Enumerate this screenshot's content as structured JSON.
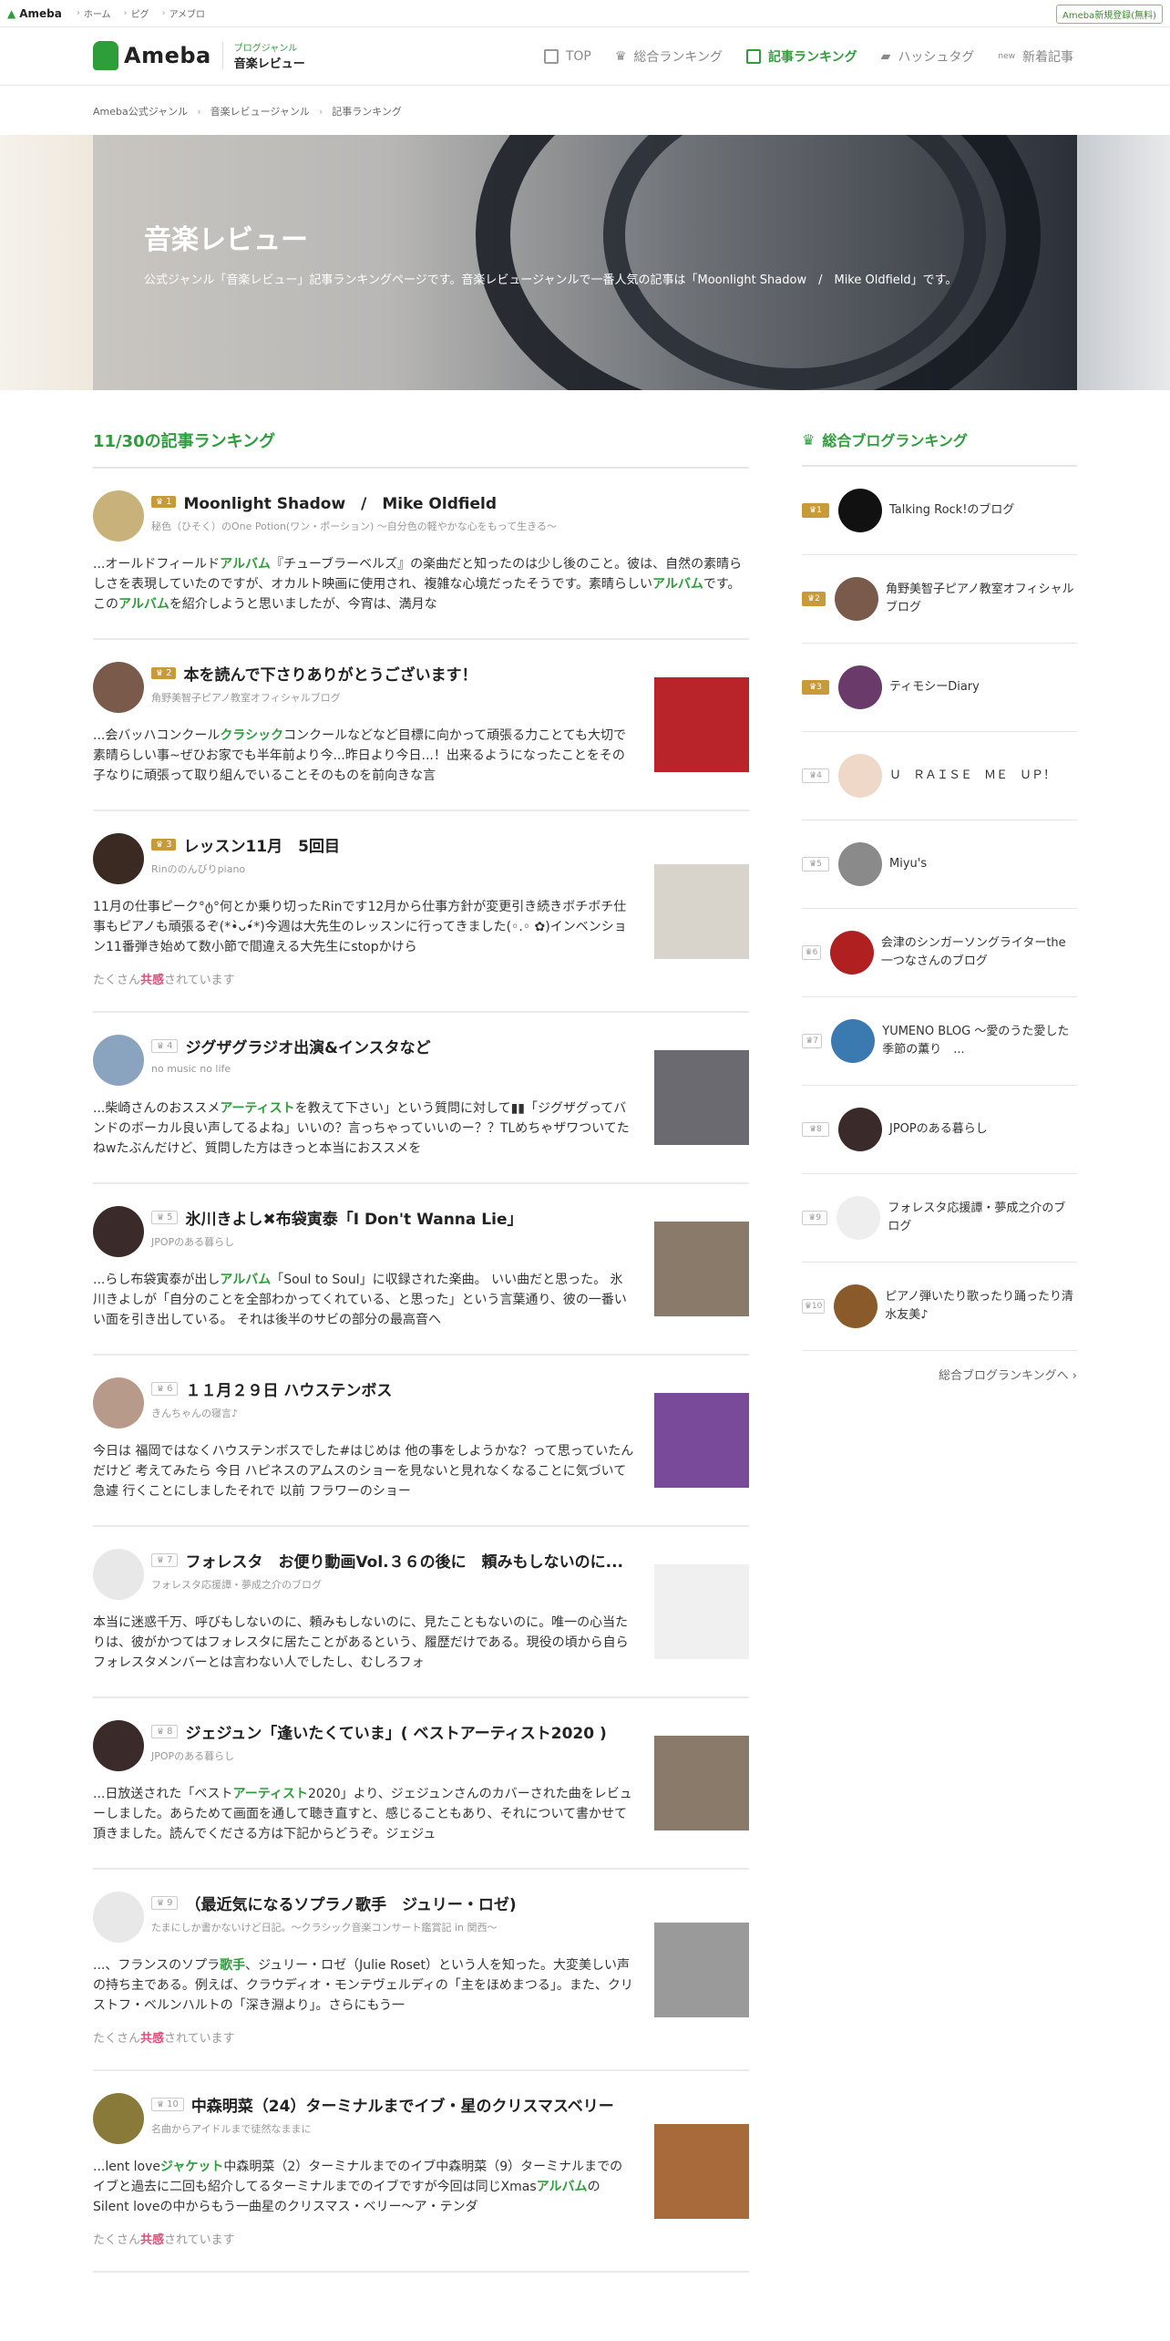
{
  "topbar": {
    "logo": "Ameba",
    "links": [
      "ホーム",
      "ピグ",
      "アメブロ"
    ],
    "register": "Ameba新規登録(無料)"
  },
  "header": {
    "brand": "Ameba",
    "genre_small": "ブログジャンル",
    "genre_name": "音楽レビュー",
    "nav": [
      {
        "label": "TOP",
        "icon": "page-icon"
      },
      {
        "label": "総合ランキング",
        "icon": "crown-icon"
      },
      {
        "label": "記事ランキング",
        "icon": "article-icon",
        "active": true
      },
      {
        "label": "ハッシュタグ",
        "icon": "tag-icon"
      },
      {
        "label": "新着記事",
        "icon": "new-icon"
      }
    ]
  },
  "breadcrumb": [
    "Ameba公式ジャンル",
    "音楽レビュージャンル",
    "記事ランキング"
  ],
  "hero": {
    "title": "音楽レビュー",
    "desc": "公式ジャンル「音楽レビュー」記事ランキングページです。音楽レビュージャンルで一番人気の記事は「Moonlight Shadow　/　Mike Oldfield」です。"
  },
  "ranking": {
    "title": "11/30の記事ランキング",
    "kyokan_pre": "たくさん",
    "kyokan_word": "共感",
    "kyokan_post": "されています",
    "entries": [
      {
        "rank": "1",
        "title": "Moonlight Shadow　/　Mike Oldfield",
        "blog": "秘色（ひそく）のOne Potion(ワン・ポーション) ～自分色の軽やかな心をもって生きる～",
        "body": "...オールドフィールドアルバム『チューブラーベルズ』の楽曲だと知ったのは少し後のこと。彼は、自然の素晴らしさを表現していたのですが、オカルト映画に使用され、複雑な心境だったそうです。素晴らしいアルバムです。このアルバムを紹介しようと思いましたが、今宵は、満月な",
        "thumb": false,
        "kyokan": false,
        "av": "#c9b27a"
      },
      {
        "rank": "2",
        "title": "本を読んで下さりありがとうございます！",
        "blog": "角野美智子ピアノ教室オフィシャルブログ",
        "body": "...会バッハコンクールクラシックコンクールなどなど目標に向かって頑張る力ことても大切で素晴らしい事~ぜひお家でも半年前より今...昨日より今日...！出来るようになったことをその子なりに頑張って取り組んでいることそのものを前向きな言",
        "thumb": true,
        "kyokan": false,
        "av": "#7a5a4a",
        "tc": "#b8242a"
      },
      {
        "rank": "3",
        "title": "レッスン11月　5回目",
        "blog": "Rinののんびりpiano",
        "body": "11月の仕事ピーク°ტ°何とか乗り切ったRinです12月から仕事方針が変更引き続きボチボチ仕事もピアノも頑張るぞ(*•̀ᴗ•́*)今週は大先生のレッスンに行ってきました(◦.◦ ✿)インベンション11番弾き始めて数小節で間違える大先生にstopかけら",
        "thumb": true,
        "kyokan": true,
        "av": "#3a2a22",
        "tc": "#d8d4cc"
      },
      {
        "rank": "4",
        "title": "ジグザグラジオ出演&インスタなど",
        "blog": "no music no life",
        "body": "...柴崎さんのおススメアーティストを教えて下さい」という質問に対して▮▮「ジグザグってバンドのボーカル良い声してるよね」いいの？言っちゃっていいのー？？TLめちゃザワついてたねwたぶんだけど、質問した方はきっと本当におススメを",
        "thumb": true,
        "kyokan": false,
        "av": "#8aa4c0",
        "tc": "#6a6a70"
      },
      {
        "rank": "5",
        "title": "氷川きよし✖布袋寅泰「I Don't Wanna Lie」",
        "blog": "JPOPのある暮らし",
        "body": "...らし布袋寅泰が出しアルバム「Soul to Soul」に収録された楽曲。 いい曲だと思った。 氷川きよしが「自分のことを全部わかってくれている、と思った」という言葉通り、彼の一番いい面を引き出している。 それは後半のサビの部分の最高音へ",
        "thumb": true,
        "kyokan": false,
        "av": "#3a2a2a",
        "tc": "#8a7a6a"
      },
      {
        "rank": "6",
        "title": "１１月２９日 ハウステンボス",
        "blog": "きんちゃんの寝言♪",
        "body": "今日は 福岡ではなくハウステンボスでした#はじめは 他の事をしようかな？って思っていたんだけど 考えてみたら 今日 ハピネスのアムスのショーを見ないと見れなくなることに気づいて 急遽 行くことにしましたそれで 以前 フラワーのショー",
        "thumb": true,
        "kyokan": false,
        "av": "#b89a8a",
        "tc": "#7a4a9a"
      },
      {
        "rank": "7",
        "title": "フォレスタ　お便り動画Vol.３６の後に　頼みもしないのに...",
        "blog": "フォレスタ応援譚・夢成之介のブログ",
        "body": "本当に迷惑千万、呼びもしないのに、頼みもしないのに、見たこともないのに。唯一の心当たりは、彼がかつてはフォレスタに居たことがあるという、履歴だけである。現役の頃から自らフォレスタメンバーとは言わない人でしたし、むしろフォ",
        "thumb": true,
        "kyokan": false,
        "av": "#e8e8e8",
        "tc": "#f0f0f0"
      },
      {
        "rank": "8",
        "title": "ジェジュン「逢いたくていま」( ベストアーティスト2020 )",
        "blog": "JPOPのある暮らし",
        "body": "...日放送された「ベストアーティスト2020」より、ジェジュンさんのカバーされた曲をレビューしました。あらためて画面を通して聴き直すと、感じることもあり、それについて書かせて頂きました。読んでくださる方は下記からどうぞ。ジェジュ",
        "thumb": true,
        "kyokan": false,
        "av": "#3a2a2a",
        "tc": "#8a7a6a"
      },
      {
        "rank": "9",
        "title": "（最近気になるソプラノ歌手　ジュリー・ロゼ)",
        "blog": "たまにしか書かないけど日記。～クラシック音楽コンサート鑑賞記 in 関西～",
        "body": "...、フランスのソプラ歌手、ジュリー・ロゼ（Julie Roset）という人を知った。大変美しい声の持ち主である。例えば、クラウディオ・モンテヴェルディの「主をほめまつる」。また、クリストフ・ベルンハルトの「深き淵より」。さらにもう一",
        "thumb": true,
        "kyokan": true,
        "av": "#e8e8e8",
        "tc": "#9a9a9a"
      },
      {
        "rank": "10",
        "title": "中森明菜（24）ターミナルまでイブ・星のクリスマスベリー",
        "blog": "名曲からアイドルまで徒然なままに",
        "body": "...lent loveジャケット中森明菜（2）ターミナルまでのイブ中森明菜（9）ターミナルまでのイブと過去に二回も紹介してるターミナルまでのイブですが今回は同じXmasアルバムのSilent loveの中からもう一曲星のクリスマス・ベリー～ア・テンダ",
        "thumb": true,
        "kyokan": true,
        "av": "#8a7a3a",
        "tc": "#a86a3a"
      }
    ]
  },
  "side": {
    "title": "総合ブログランキング",
    "more": "総合ブログランキングへ",
    "items": [
      {
        "rank": "1",
        "name": "Talking Rock!のブログ",
        "av": "#111"
      },
      {
        "rank": "2",
        "name": "角野美智子ピアノ教室オフィシャルブログ",
        "av": "#7a5a4a"
      },
      {
        "rank": "3",
        "name": "ティモシーDiary",
        "av": "#6a3a6a"
      },
      {
        "rank": "4",
        "name": "Ｕ　ＲＡＩＳＥ　ＭＥ　ＵＰ！",
        "av": "#f0d8c8"
      },
      {
        "rank": "5",
        "name": "Miyu's",
        "av": "#8a8a8a"
      },
      {
        "rank": "6",
        "name": "会津のシンガーソングライターthe一つなさんのブログ",
        "av": "#b02020"
      },
      {
        "rank": "7",
        "name": "YUMENO BLOG ～愛のうた愛した季節の薫り　...",
        "av": "#3a7ab0"
      },
      {
        "rank": "8",
        "name": "JPOPのある暮らし",
        "av": "#3a2a2a"
      },
      {
        "rank": "9",
        "name": "フォレスタ応援譚・夢成之介のブログ",
        "av": "#eee"
      },
      {
        "rank": "10",
        "name": "ピアノ弾いたり歌ったり踊ったり清水友美♪",
        "av": "#8a5a2a"
      }
    ]
  }
}
